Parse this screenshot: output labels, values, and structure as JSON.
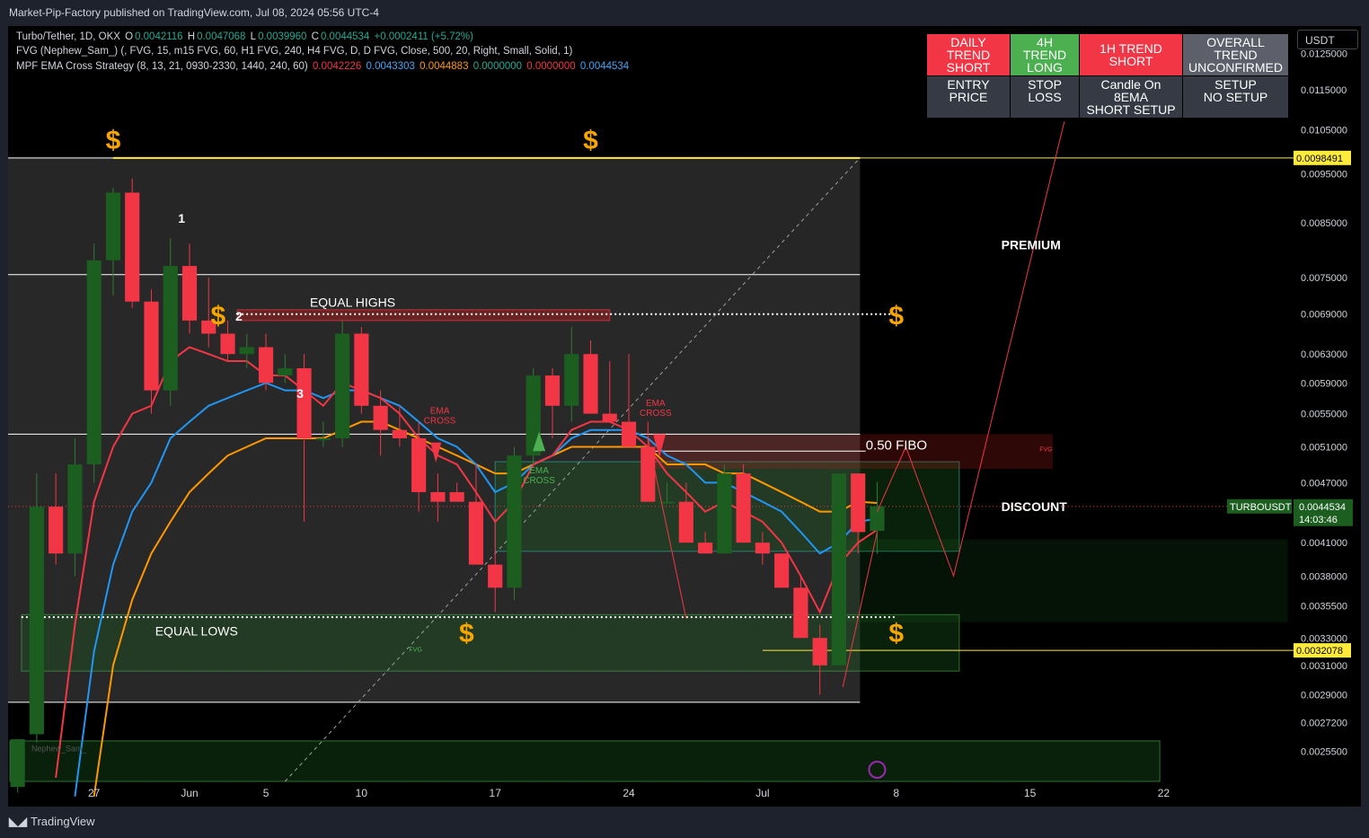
{
  "header": {
    "published": "Market-Pip-Factory published on TradingView.com, Jul 08, 2024 05:56 UTC-4",
    "currency": "USDT",
    "footer_brand": "TradingView"
  },
  "legend": {
    "line1": {
      "symbol": "Turbo/Tether, 1D, OKX",
      "o_label": "O",
      "o_val": "0.0042116",
      "h_label": "H",
      "h_val": "0.0047068",
      "l_label": "L",
      "l_val": "0.0039960",
      "c_label": "C",
      "c_val": "0.0044534",
      "chg": "+0.0002411 (+5.72%)"
    },
    "line2": "FVG (Nephew_Sam_) (, FVG, 15, m15 FVG, 60, H1 FVG, 240, H4 FVG, D, D FVG, Close, 500, 20, Right, Small, Solid, 1)",
    "line3": {
      "name": "MPF EMA Cross Strategy (8, 13, 21, 0930-2330, 1440, 240, 60)",
      "v1": "0.0042226",
      "v2": "0.0043303",
      "v3": "0.0044883",
      "v4": "0.0000000",
      "v5": "0.0000000",
      "v6": "0.0044534"
    }
  },
  "trend_table": {
    "daily": "DAILY TREND\nSHORT",
    "h4": "4H TREND\nLONG",
    "h1": "1H TREND\nSHORT",
    "overall": "OVERALL TREND\nUNCONFIRMED",
    "entry": "ENTRY PRICE",
    "stop": "STOP LOSS",
    "candle": "Candle On 8EMA\nSHORT SETUP",
    "setup": "SETUP\nNO SETUP",
    "colors": {
      "short": "#f23645",
      "long": "#4caf50"
    }
  },
  "chart_data": {
    "type": "candlestick",
    "symbol": "Turbo/Tether",
    "interval": "1D",
    "exchange": "OKX",
    "yscale": "log",
    "ylim": [
      0.00238,
      0.0133
    ],
    "y_ticks": [
      "0.0125000",
      "0.0115000",
      "0.0105000",
      "0.0095000",
      "0.0085000",
      "0.0075000",
      "0.0069000",
      "0.0063000",
      "0.0059000",
      "0.0055000",
      "0.0051000",
      "0.0047000",
      "0.0041000",
      "0.0038000",
      "0.0035500",
      "0.0033000",
      "0.0031000",
      "0.0029000",
      "0.0027200",
      "0.0025500"
    ],
    "x_ticks": [
      {
        "label": "27",
        "day": 0
      },
      {
        "label": "Jun",
        "day": 5
      },
      {
        "label": "5",
        "day": 9
      },
      {
        "label": "10",
        "day": 14
      },
      {
        "label": "17",
        "day": 21
      },
      {
        "label": "24",
        "day": 28
      },
      {
        "label": "Jul",
        "day": 35
      },
      {
        "label": "8",
        "day": 42
      },
      {
        "label": "15",
        "day": 49
      },
      {
        "label": "22",
        "day": 56
      }
    ],
    "x_day_range": [
      -4.5,
      62.8
    ],
    "candles": [
      {
        "d": -4,
        "o": 0.00235,
        "h": 0.0026,
        "l": 0.00232,
        "c": 0.00262
      },
      {
        "d": -3,
        "o": 0.00265,
        "h": 0.0048,
        "l": 0.0026,
        "c": 0.00445
      },
      {
        "d": -2,
        "o": 0.00445,
        "h": 0.0048,
        "l": 0.0039,
        "c": 0.004
      },
      {
        "d": -1,
        "o": 0.004,
        "h": 0.0052,
        "l": 0.0038,
        "c": 0.0049
      },
      {
        "d": 0,
        "o": 0.0049,
        "h": 0.0081,
        "l": 0.0047,
        "c": 0.0078
      },
      {
        "d": 1,
        "o": 0.0078,
        "h": 0.0092,
        "l": 0.0072,
        "c": 0.0091
      },
      {
        "d": 2,
        "o": 0.0091,
        "h": 0.0094,
        "l": 0.007,
        "c": 0.0071
      },
      {
        "d": 3,
        "o": 0.0071,
        "h": 0.0073,
        "l": 0.0055,
        "c": 0.0058
      },
      {
        "d": 4,
        "o": 0.0058,
        "h": 0.0082,
        "l": 0.0056,
        "c": 0.0077
      },
      {
        "d": 5,
        "o": 0.0077,
        "h": 0.0081,
        "l": 0.0066,
        "c": 0.0068
      },
      {
        "d": 6,
        "o": 0.0068,
        "h": 0.0075,
        "l": 0.0064,
        "c": 0.0066
      },
      {
        "d": 7,
        "o": 0.0066,
        "h": 0.0068,
        "l": 0.0062,
        "c": 0.0063
      },
      {
        "d": 8,
        "o": 0.0063,
        "h": 0.0066,
        "l": 0.0061,
        "c": 0.0064
      },
      {
        "d": 9,
        "o": 0.0064,
        "h": 0.0066,
        "l": 0.0058,
        "c": 0.0059
      },
      {
        "d": 10,
        "o": 0.006,
        "h": 0.0063,
        "l": 0.0059,
        "c": 0.0061
      },
      {
        "d": 11,
        "o": 0.0061,
        "h": 0.0063,
        "l": 0.0043,
        "c": 0.0052
      },
      {
        "d": 12,
        "o": 0.0052,
        "h": 0.0054,
        "l": 0.0051,
        "c": 0.0052
      },
      {
        "d": 13,
        "o": 0.0052,
        "h": 0.0068,
        "l": 0.0051,
        "c": 0.0066
      },
      {
        "d": 14,
        "o": 0.0066,
        "h": 0.0067,
        "l": 0.0055,
        "c": 0.0056
      },
      {
        "d": 15,
        "o": 0.0056,
        "h": 0.0058,
        "l": 0.005,
        "c": 0.0053
      },
      {
        "d": 16,
        "o": 0.0053,
        "h": 0.0056,
        "l": 0.0051,
        "c": 0.0052
      },
      {
        "d": 17,
        "o": 0.0052,
        "h": 0.0054,
        "l": 0.0044,
        "c": 0.0046
      },
      {
        "d": 18,
        "o": 0.0046,
        "h": 0.0048,
        "l": 0.0043,
        "c": 0.0045
      },
      {
        "d": 19,
        "o": 0.0046,
        "h": 0.0047,
        "l": 0.0045,
        "c": 0.0045
      },
      {
        "d": 20,
        "o": 0.0045,
        "h": 0.0049,
        "l": 0.0042,
        "c": 0.0039
      },
      {
        "d": 21,
        "o": 0.0039,
        "h": 0.0043,
        "l": 0.0035,
        "c": 0.0037
      },
      {
        "d": 22,
        "o": 0.0037,
        "h": 0.0051,
        "l": 0.0036,
        "c": 0.005
      },
      {
        "d": 23,
        "o": 0.005,
        "h": 0.0061,
        "l": 0.0049,
        "c": 0.006
      },
      {
        "d": 24,
        "o": 0.006,
        "h": 0.0061,
        "l": 0.0052,
        "c": 0.0056
      },
      {
        "d": 25,
        "o": 0.0056,
        "h": 0.0067,
        "l": 0.0054,
        "c": 0.0063
      },
      {
        "d": 26,
        "o": 0.0063,
        "h": 0.0065,
        "l": 0.0055,
        "c": 0.0055
      },
      {
        "d": 27,
        "o": 0.0055,
        "h": 0.0062,
        "l": 0.0054,
        "c": 0.0054
      },
      {
        "d": 28,
        "o": 0.0054,
        "h": 0.0063,
        "l": 0.0052,
        "c": 0.0051
      },
      {
        "d": 29,
        "o": 0.0051,
        "h": 0.0054,
        "l": 0.0045,
        "c": 0.0045
      },
      {
        "d": 30,
        "o": 0.0045,
        "h": 0.0047,
        "l": 0.0045,
        "c": 0.0045
      },
      {
        "d": 31,
        "o": 0.0045,
        "h": 0.0047,
        "l": 0.0041,
        "c": 0.0041
      },
      {
        "d": 32,
        "o": 0.0041,
        "h": 0.0042,
        "l": 0.004,
        "c": 0.004
      },
      {
        "d": 33,
        "o": 0.004,
        "h": 0.0049,
        "l": 0.004,
        "c": 0.0048
      },
      {
        "d": 34,
        "o": 0.0048,
        "h": 0.0049,
        "l": 0.0041,
        "c": 0.0041
      },
      {
        "d": 35,
        "o": 0.0041,
        "h": 0.0042,
        "l": 0.0039,
        "c": 0.004
      },
      {
        "d": 36,
        "o": 0.004,
        "h": 0.004,
        "l": 0.0037,
        "c": 0.0037
      },
      {
        "d": 37,
        "o": 0.0037,
        "h": 0.0038,
        "l": 0.0033,
        "c": 0.0033
      },
      {
        "d": 38,
        "o": 0.0033,
        "h": 0.0034,
        "l": 0.0029,
        "c": 0.0031
      },
      {
        "d": 39,
        "o": 0.0031,
        "h": 0.0048,
        "l": 0.0031,
        "c": 0.0048
      },
      {
        "d": 40,
        "o": 0.0048,
        "h": 0.0048,
        "l": 0.004,
        "c": 0.0042
      },
      {
        "d": 41,
        "o": 0.0042116,
        "h": 0.0047068,
        "l": 0.003996,
        "c": 0.0044534
      }
    ],
    "ema_fast": [
      [
        -2,
        0.0024
      ],
      [
        -1,
        0.0034
      ],
      [
        0,
        0.0045
      ],
      [
        1,
        0.0051
      ],
      [
        2,
        0.0055
      ],
      [
        3,
        0.0056
      ],
      [
        4,
        0.0062
      ],
      [
        5,
        0.0064
      ],
      [
        6,
        0.0063
      ],
      [
        7,
        0.0062
      ],
      [
        8,
        0.0062
      ],
      [
        9,
        0.006
      ],
      [
        10,
        0.006
      ],
      [
        11,
        0.0058
      ],
      [
        12,
        0.0056
      ],
      [
        13,
        0.0059
      ],
      [
        14,
        0.0058
      ],
      [
        15,
        0.0057
      ],
      [
        16,
        0.0055
      ],
      [
        17,
        0.0052
      ],
      [
        18,
        0.005
      ],
      [
        19,
        0.0049
      ],
      [
        20,
        0.0046
      ],
      [
        21,
        0.0043
      ],
      [
        22,
        0.0045
      ],
      [
        23,
        0.0049
      ],
      [
        24,
        0.005
      ],
      [
        25,
        0.0053
      ],
      [
        26,
        0.0054
      ],
      [
        27,
        0.0054
      ],
      [
        28,
        0.0053
      ],
      [
        29,
        0.0051
      ],
      [
        30,
        0.0048
      ],
      [
        31,
        0.0046
      ],
      [
        32,
        0.0044
      ],
      [
        33,
        0.0045
      ],
      [
        34,
        0.0044
      ],
      [
        35,
        0.0043
      ],
      [
        36,
        0.0041
      ],
      [
        37,
        0.0038
      ],
      [
        38,
        0.0035
      ],
      [
        39,
        0.0039
      ],
      [
        40,
        0.0041
      ],
      [
        41,
        0.0042226
      ]
    ],
    "ema_mid": [
      [
        -1,
        0.0023
      ],
      [
        0,
        0.0032
      ],
      [
        1,
        0.0039
      ],
      [
        2,
        0.0044
      ],
      [
        3,
        0.0047
      ],
      [
        4,
        0.0052
      ],
      [
        5,
        0.0054
      ],
      [
        6,
        0.0056
      ],
      [
        7,
        0.0057
      ],
      [
        8,
        0.0058
      ],
      [
        9,
        0.0059
      ],
      [
        10,
        0.0058
      ],
      [
        11,
        0.0058
      ],
      [
        12,
        0.0057
      ],
      [
        13,
        0.0058
      ],
      [
        14,
        0.0058
      ],
      [
        15,
        0.0057
      ],
      [
        16,
        0.0056
      ],
      [
        17,
        0.0054
      ],
      [
        18,
        0.0052
      ],
      [
        19,
        0.0051
      ],
      [
        20,
        0.0049
      ],
      [
        21,
        0.0046
      ],
      [
        22,
        0.0047
      ],
      [
        23,
        0.0049
      ],
      [
        24,
        0.005
      ],
      [
        25,
        0.0052
      ],
      [
        26,
        0.0053
      ],
      [
        27,
        0.0053
      ],
      [
        28,
        0.0053
      ],
      [
        29,
        0.0052
      ],
      [
        30,
        0.005
      ],
      [
        31,
        0.0049
      ],
      [
        32,
        0.0047
      ],
      [
        33,
        0.0047
      ],
      [
        34,
        0.0046
      ],
      [
        35,
        0.0045
      ],
      [
        36,
        0.0044
      ],
      [
        37,
        0.0042
      ],
      [
        38,
        0.004
      ],
      [
        39,
        0.0041
      ],
      [
        40,
        0.0043
      ],
      [
        41,
        0.0043303
      ]
    ],
    "ema_slow": [
      [
        0,
        0.0023
      ],
      [
        1,
        0.0031
      ],
      [
        2,
        0.0036
      ],
      [
        3,
        0.004
      ],
      [
        4,
        0.0043
      ],
      [
        5,
        0.0046
      ],
      [
        6,
        0.0048
      ],
      [
        7,
        0.005
      ],
      [
        8,
        0.0051
      ],
      [
        9,
        0.0052
      ],
      [
        10,
        0.0052
      ],
      [
        11,
        0.0052
      ],
      [
        12,
        0.0052
      ],
      [
        13,
        0.0053
      ],
      [
        14,
        0.0054
      ],
      [
        15,
        0.0054
      ],
      [
        16,
        0.0053
      ],
      [
        17,
        0.0052
      ],
      [
        18,
        0.0051
      ],
      [
        19,
        0.005
      ],
      [
        20,
        0.0049
      ],
      [
        21,
        0.0048
      ],
      [
        22,
        0.0048
      ],
      [
        23,
        0.0049
      ],
      [
        24,
        0.005
      ],
      [
        25,
        0.0051
      ],
      [
        26,
        0.0051
      ],
      [
        27,
        0.0051
      ],
      [
        28,
        0.0051
      ],
      [
        29,
        0.0051
      ],
      [
        30,
        0.0049
      ],
      [
        31,
        0.0049
      ],
      [
        32,
        0.0049
      ],
      [
        33,
        0.0048
      ],
      [
        34,
        0.0048
      ],
      [
        35,
        0.0047
      ],
      [
        36,
        0.0046
      ],
      [
        37,
        0.0045
      ],
      [
        38,
        0.0044
      ],
      [
        39,
        0.0044
      ],
      [
        40,
        0.0045
      ],
      [
        41,
        0.0044883
      ]
    ],
    "levels": {
      "range_high": 0.0098491,
      "range_low": 0.0032078,
      "fib_050": 0.00505,
      "equal_highs": 0.0069,
      "equal_lows": 0.00346,
      "white_lines": [
        0.0098491,
        0.00755,
        0.00525,
        0.00285
      ]
    },
    "current_price": {
      "symbol": "TURBOUSDT",
      "price": "0.0044534",
      "countdown": "14:03:46"
    },
    "price_labels": {
      "top": "0.0098491",
      "bottom": "0.0032078"
    },
    "annotations": {
      "equal_highs": "EQUAL HIGHS",
      "equal_lows": "EQUAL LOWS",
      "fibo": "0.50 FIBO",
      "premium": "PREMIUM",
      "discount": "DISCOUNT",
      "ema_cross": "EMA\nCROSS",
      "fvg": "FVG",
      "num1": "1",
      "num2": "2",
      "num3": "3",
      "dollar": "$",
      "watermark": "Nephew_Sam_"
    },
    "colors": {
      "up": "#1b5e20",
      "down": "#f23645",
      "ema_fast": "#f23645",
      "ema_mid": "#2196f3",
      "ema_slow": "#ff9800",
      "accent": "#f7a600",
      "yellow": "#ffeb3b"
    }
  }
}
